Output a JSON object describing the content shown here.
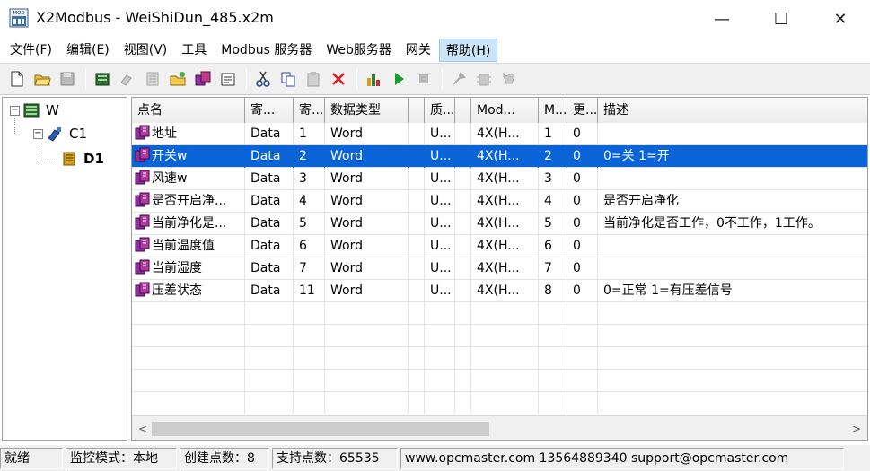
{
  "window": {
    "title": "X2Modbus - WeiShiDun_485.x2m",
    "icon_label": "MOD",
    "minimize": "—",
    "maximize": "☐",
    "close": "✕"
  },
  "menu": [
    {
      "label": "文件(F)"
    },
    {
      "label": "编辑(E)"
    },
    {
      "label": "视图(V)"
    },
    {
      "label": "工具"
    },
    {
      "label": "Modbus 服务器"
    },
    {
      "label": "Web服务器"
    },
    {
      "label": "网关"
    },
    {
      "label": "帮助(H)"
    }
  ],
  "tree": {
    "root": "W",
    "channel": "C1",
    "device": "D1"
  },
  "grid": {
    "columns": [
      "点名",
      "寄...",
      "寄...",
      "数据类型",
      "",
      "质...",
      "",
      "Mod...",
      "M...",
      "更...",
      "描述"
    ],
    "rows": [
      {
        "name": "地址",
        "c1": "Data",
        "c2": "1",
        "type": "Word",
        "c4": "",
        "c5": "U...",
        "c6": "",
        "mod": "4X(H...",
        "m": "1",
        "upd": "0",
        "desc": ""
      },
      {
        "name": "开关w",
        "c1": "Data",
        "c2": "2",
        "type": "Word",
        "c4": "",
        "c5": "U...",
        "c6": "",
        "mod": "4X(H...",
        "m": "2",
        "upd": "0",
        "desc": "0=关 1=开"
      },
      {
        "name": "风速w",
        "c1": "Data",
        "c2": "3",
        "type": "Word",
        "c4": "",
        "c5": "U...",
        "c6": "",
        "mod": "4X(H...",
        "m": "3",
        "upd": "0",
        "desc": ""
      },
      {
        "name": "是否开启净...",
        "c1": "Data",
        "c2": "4",
        "type": "Word",
        "c4": "",
        "c5": "U...",
        "c6": "",
        "mod": "4X(H...",
        "m": "4",
        "upd": "0",
        "desc": "是否开启净化"
      },
      {
        "name": "当前净化是...",
        "c1": "Data",
        "c2": "5",
        "type": "Word",
        "c4": "",
        "c5": "U...",
        "c6": "",
        "mod": "4X(H...",
        "m": "5",
        "upd": "0",
        "desc": "当前净化是否工作，0不工作，1工作。"
      },
      {
        "name": "当前温度值",
        "c1": "Data",
        "c2": "6",
        "type": "Word",
        "c4": "",
        "c5": "U...",
        "c6": "",
        "mod": "4X(H...",
        "m": "6",
        "upd": "0",
        "desc": ""
      },
      {
        "name": "当前湿度",
        "c1": "Data",
        "c2": "7",
        "type": "Word",
        "c4": "",
        "c5": "U...",
        "c6": "",
        "mod": "4X(H...",
        "m": "7",
        "upd": "0",
        "desc": ""
      },
      {
        "name": "压差状态",
        "c1": "Data",
        "c2": "11",
        "type": "Word",
        "c4": "",
        "c5": "U...",
        "c6": "",
        "mod": "4X(H...",
        "m": "8",
        "upd": "0",
        "desc": "0=正常 1=有压差信号"
      }
    ],
    "selected_index": 1
  },
  "scrollbar": {
    "left_arrow": "<",
    "right_arrow": ">",
    "position": 0.0
  },
  "status": {
    "ready": "就绪",
    "mode": "监控模式：本地",
    "created": "创建点数：8",
    "supported": "支持点数：65535",
    "contact": "www.opcmaster.com 13564889340 support@opcmaster.com"
  },
  "colors": {
    "selection": "#0a64d8",
    "menu_active": "#cce4f7",
    "tag_icon": "#8e2f9e"
  }
}
